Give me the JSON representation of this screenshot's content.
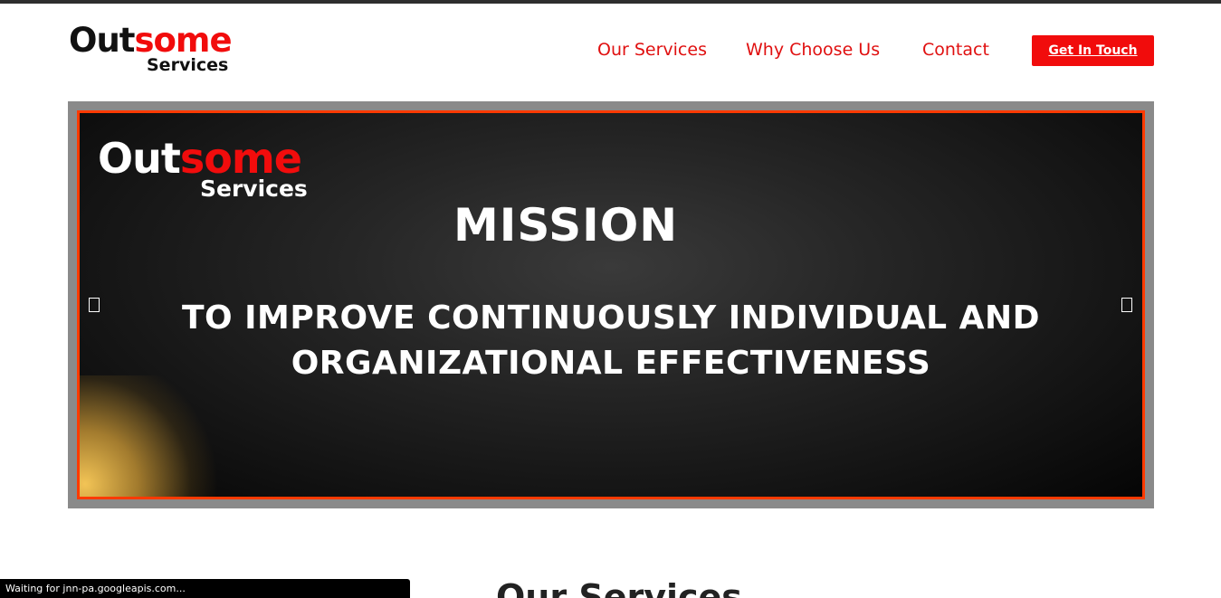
{
  "header": {
    "logo": {
      "line1_a": "Out",
      "line1_b": "some",
      "line2": "Services"
    },
    "nav": [
      {
        "label": "Our Services"
      },
      {
        "label": "Why Choose Us"
      },
      {
        "label": "Contact"
      }
    ],
    "cta_label": "Get In Touch"
  },
  "hero": {
    "logo": {
      "line1_a": "Out",
      "line1_b": "some",
      "line2": "Services"
    },
    "heading": "MISSION",
    "body_line1": "TO IMPROVE CONTINUOUSLY INDIVIDUAL AND",
    "body_line2": "ORGANIZATIONAL  EFFECTIVENESS",
    "prev_icon": "chevron-left-icon",
    "next_icon": "chevron-right-icon"
  },
  "next_section": {
    "title": "Our Services"
  },
  "status_bar": {
    "text": "Waiting for jnn-pa.googleapis.com..."
  },
  "colors": {
    "accent": "#f10c0c",
    "slide_border": "#ff3a00",
    "frame": "#8a8a8a"
  }
}
